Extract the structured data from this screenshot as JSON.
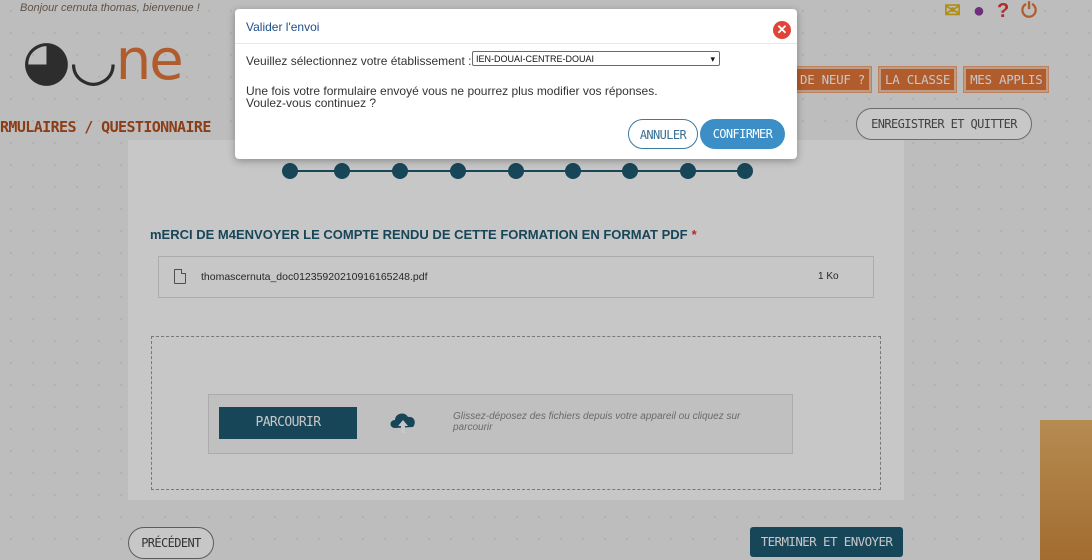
{
  "header": {
    "greeting": "Bonjour cernuta thomas, bienvenue !",
    "logo_text": "ne",
    "logo_face": "◕◡",
    "icons": [
      "mail-icon",
      "user-icon",
      "help-icon",
      "power-icon"
    ]
  },
  "nav": {
    "items": [
      {
        "label": "DE NEUF ?"
      },
      {
        "label": "LA CLASSE"
      },
      {
        "label": "MES APPLIS"
      }
    ]
  },
  "page": {
    "title": "RMULAIRES / QUESTIONNAIRE",
    "save_quit_label": "ENREGISTRER ET QUITTER"
  },
  "steps": {
    "count": 9
  },
  "form": {
    "question": "mERCI DE M4ENVOYER LE COMPTE RENDU DE CETTE FORMATION EN FORMAT PDF",
    "required_mark": "*",
    "file": {
      "name": "thomascernuta_doc01235920210916165248.pdf",
      "size": "1 Ko"
    },
    "upload": {
      "browse_label": "PARCOURIR",
      "hint": "Glissez-déposez des fichiers depuis votre appareil ou cliquez sur parcourir"
    }
  },
  "footer": {
    "prev_label": "PRÉCÉDENT",
    "finish_label": "TERMINER ET ENVOYER"
  },
  "modal": {
    "title": "Valider l'envoi",
    "close_icon": "close-icon",
    "select_label": "Veuillez sélectionnez votre établissement :",
    "select_value": "IEN-DOUAI-CENTRE-DOUAI",
    "warning_line1": "Une fois votre formulaire envoyé vous ne pourrez plus modifier vos réponses.",
    "warning_line2": "Voulez-vous continuez ?",
    "cancel_label": "ANNULER",
    "confirm_label": "CONFIRMER"
  },
  "colors": {
    "accent_orange": "#e2773a",
    "primary_teal": "#1f5a72",
    "confirm_blue": "#3b8fc6",
    "close_red": "#e04438"
  }
}
